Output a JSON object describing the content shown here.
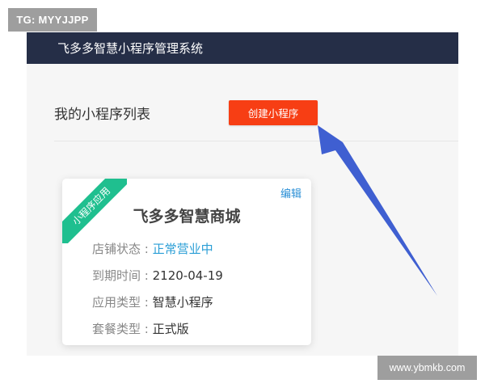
{
  "watermarks": {
    "top": "TG: MYYJJPP",
    "bottom": "www.ybmkb.com"
  },
  "header": {
    "title": "飞多多智慧小程序管理系统"
  },
  "toolbar": {
    "section_title": "我的小程序列表",
    "create_button": "创建小程序"
  },
  "card": {
    "ribbon": "小程序应用",
    "edit": "编辑",
    "title": "飞多多智慧商城",
    "rows": [
      {
        "label": "店铺状态 :",
        "value": "正常营业中"
      },
      {
        "label": "到期时间 :",
        "value": "2120-04-19"
      },
      {
        "label": "应用类型 :",
        "value": "智慧小程序"
      },
      {
        "label": "套餐类型 :",
        "value": "正式版"
      }
    ]
  },
  "colors": {
    "header_bg": "#252e47",
    "primary_button": "#f73e14",
    "ribbon": "#1fbf8f",
    "status_active": "#2a9ed6",
    "arrow": "#3f5fd1"
  },
  "icons": {
    "annotation": "arrow-pointer-icon"
  }
}
